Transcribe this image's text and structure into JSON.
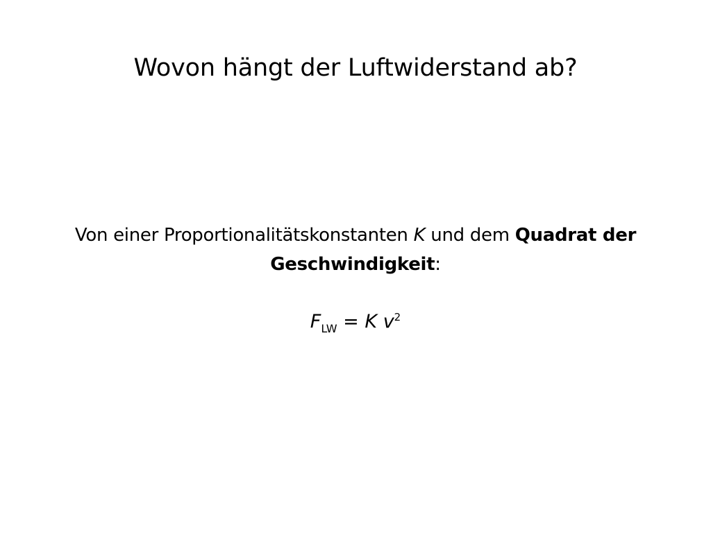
{
  "slide": {
    "title": "Wovon hängt der Luftwiderstand ab?",
    "body": {
      "part1": "Von einer Proportionalitätskonstanten ",
      "constant": "K",
      "part2": " und dem ",
      "bold": "Quadrat der Geschwindigkeit",
      "part3": ":"
    },
    "formula": {
      "lhs_var": "F",
      "lhs_sub": "LW",
      "equals": " = ",
      "rhs_const": "K",
      "space": " ",
      "rhs_var": "v",
      "rhs_exp": "2"
    }
  }
}
